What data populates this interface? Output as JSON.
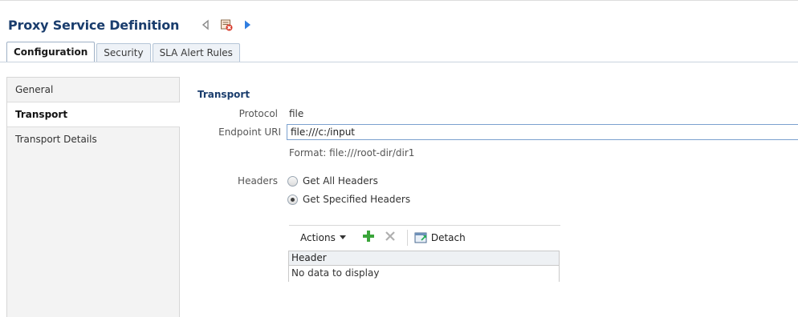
{
  "page": {
    "title": "Proxy Service Definition",
    "icons": [
      "collapse-left-icon",
      "delete-service-icon",
      "expand-right-icon"
    ]
  },
  "tabs": [
    {
      "label": "Configuration",
      "active": true
    },
    {
      "label": "Security",
      "active": false
    },
    {
      "label": "SLA Alert Rules",
      "active": false
    }
  ],
  "sidebar": {
    "items": [
      {
        "label": "General",
        "selected": false
      },
      {
        "label": "Transport",
        "selected": true
      },
      {
        "label": "Transport Details",
        "selected": false
      }
    ]
  },
  "transport": {
    "section_title": "Transport",
    "protocol_label": "Protocol",
    "protocol_value": "file",
    "endpoint_label": "Endpoint URI",
    "endpoint_value": "file:///c:/input",
    "format_hint": "Format: file:///root-dir/dir1",
    "headers_label": "Headers",
    "header_options": [
      {
        "label": "Get All Headers",
        "checked": false
      },
      {
        "label": "Get Specified Headers",
        "checked": true
      }
    ]
  },
  "headers_table": {
    "toolbar": {
      "actions_label": "Actions",
      "detach_label": "Detach",
      "add_icon": "add-icon",
      "remove_icon": "remove-icon",
      "detach_icon": "detach-icon"
    },
    "columns": [
      "Header"
    ],
    "empty_text": "No data to display"
  },
  "colors": {
    "title": "#1a3d6d",
    "add_icon": "#3aa53a",
    "input_border": "#7ba1cf"
  }
}
